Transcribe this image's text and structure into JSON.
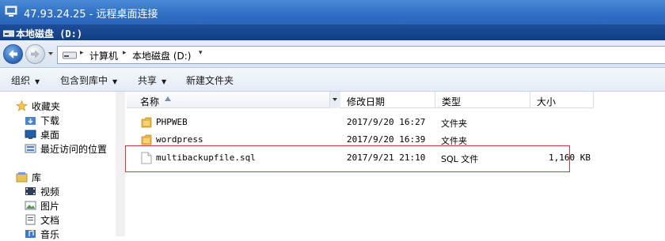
{
  "rdp": {
    "title": "47.93.24.25 - 远程桌面连接"
  },
  "window": {
    "title": "本地磁盘 (D:)"
  },
  "address": {
    "segments": [
      "计算机",
      "本地磁盘 (D:)"
    ]
  },
  "toolbar": {
    "organize": "组织",
    "include_in_library": "包含到库中",
    "share": "共享",
    "new_folder": "新建文件夹"
  },
  "nav": {
    "favorites": "收藏夹",
    "downloads": "下载",
    "desktop": "桌面",
    "recent": "最近访问的位置",
    "libraries": "库",
    "videos": "视频",
    "pictures": "图片",
    "documents": "文档",
    "music": "音乐"
  },
  "columns": {
    "name": "名称",
    "date": "修改日期",
    "type": "类型",
    "size": "大小"
  },
  "files": [
    {
      "name": "PHPWEB",
      "date": "2017/9/20 16:27",
      "type": "文件夹",
      "size": "",
      "icon": "folder-icon"
    },
    {
      "name": "wordpress",
      "date": "2017/9/20 16:39",
      "type": "文件夹",
      "size": "",
      "icon": "folder-icon"
    },
    {
      "name": "multibackupfile.sql",
      "date": "2017/9/21 21:10",
      "type": "SQL 文件",
      "size": "1,160 KB",
      "icon": "file-icon"
    }
  ],
  "colors": {
    "titlebar": "#2f6fc4",
    "caption": "#123e86",
    "highlight": "#d9333f",
    "folder": "#e7b73c"
  }
}
